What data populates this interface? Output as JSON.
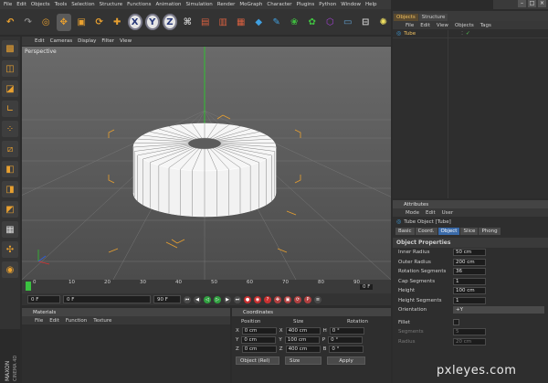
{
  "app_menu": [
    "File",
    "Edit",
    "Objects",
    "Tools",
    "Selection",
    "Structure",
    "Functions",
    "Animation",
    "Simulation",
    "Render",
    "MoGraph",
    "Character",
    "Plugins",
    "Python",
    "Window",
    "Help"
  ],
  "viewport_menu": [
    "Edit",
    "Cameras",
    "Display",
    "Filter",
    "View"
  ],
  "viewport_label": "Perspective",
  "axis_buttons": [
    "X",
    "Y",
    "Z"
  ],
  "timeline": {
    "ticks": [
      "0",
      "10",
      "20",
      "30",
      "40",
      "50",
      "60",
      "70",
      "80",
      "90"
    ],
    "frame_end_label": "0 F"
  },
  "playback": {
    "current_frame": "0 F",
    "start_frame": "0 F",
    "end_frame": "90 F"
  },
  "materials_panel": {
    "title": "Materials",
    "menu": [
      "File",
      "Edit",
      "Function",
      "Texture"
    ]
  },
  "coordinates_panel": {
    "title": "Coordinates",
    "headers": [
      "Position",
      "Size",
      "Rotation"
    ],
    "rows": [
      {
        "axis": "X",
        "position": "0 cm",
        "size_axis": "X",
        "size": "400 cm",
        "rot_axis": "H",
        "rotation": "0 °"
      },
      {
        "axis": "Y",
        "position": "0 cm",
        "size_axis": "Y",
        "size": "100 cm",
        "rot_axis": "P",
        "rotation": "0 °"
      },
      {
        "axis": "Z",
        "position": "0 cm",
        "size_axis": "Z",
        "size": "400 cm",
        "rot_axis": "B",
        "rotation": "0 °"
      }
    ],
    "mode_select": "Object (Rel)",
    "size_select": "Size",
    "apply_label": "Apply"
  },
  "objects_panel": {
    "tabs": [
      "Objects",
      "Structure"
    ],
    "active_tab": "Objects",
    "menu": [
      "File",
      "Edit",
      "View",
      "Objects",
      "Tags"
    ],
    "items": [
      {
        "name": "Tube"
      }
    ]
  },
  "attributes_panel": {
    "title": "Attributes",
    "menu": [
      "Mode",
      "Edit",
      "User"
    ],
    "object_title": "Tube Object [Tube]",
    "tabs": [
      "Basic",
      "Coord.",
      "Object",
      "Slice",
      "Phong"
    ],
    "active_tab": "Object",
    "section_title": "Object Properties",
    "fields": [
      {
        "label": "Inner Radius",
        "value": "50 cm"
      },
      {
        "label": "Outer Radius",
        "value": "200 cm"
      },
      {
        "label": "Rotation Segments",
        "value": "36"
      },
      {
        "label": "Cap Segments",
        "value": "1"
      },
      {
        "label": "Height",
        "value": "100 cm"
      },
      {
        "label": "Height Segments",
        "value": "1"
      }
    ],
    "orientation_label": "Orientation",
    "orientation_value": "+Y",
    "fillet_label": "Fillet",
    "segments_label": "Segments",
    "segments_value": "5",
    "radius_label": "Radius",
    "radius_value": "20 cm"
  },
  "branding": {
    "maxon_text": "MAXON",
    "cinema_text": "CINEMA 4D"
  },
  "watermark": "pxleyes.com",
  "colors": {
    "accent_orange": "#e8a030",
    "active_tab_blue": "#3a6aa8",
    "axis_x": "#d83030",
    "axis_y": "#30c030",
    "axis_z": "#3060e0"
  }
}
